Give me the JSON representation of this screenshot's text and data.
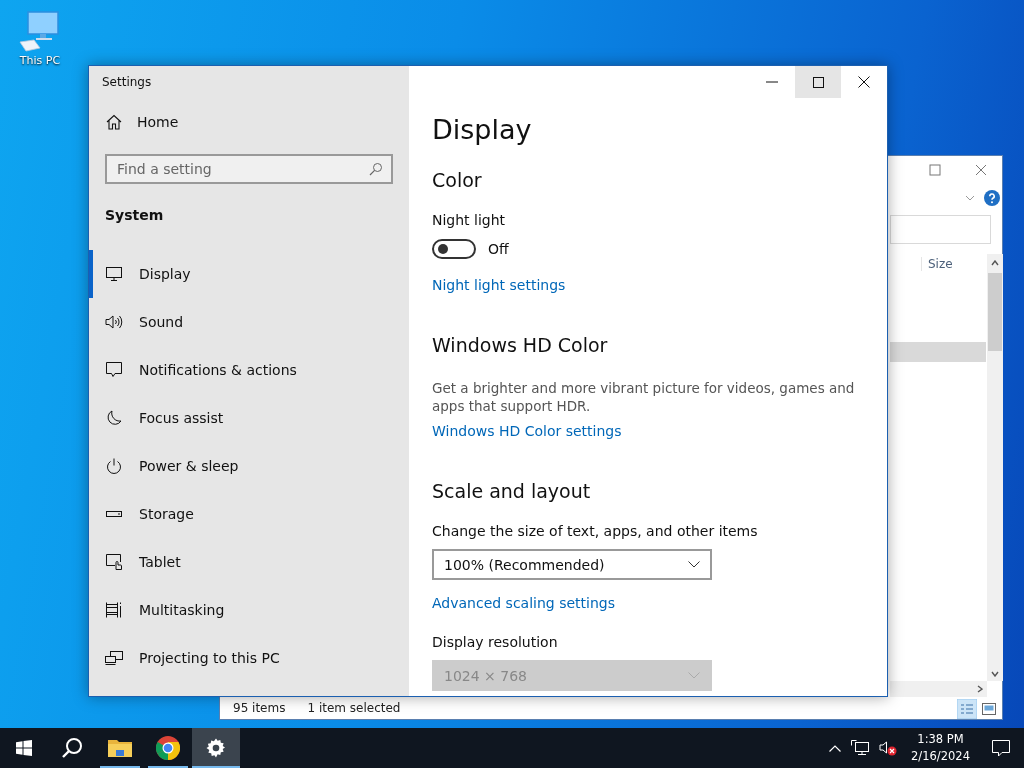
{
  "desktop": {
    "icons": [
      {
        "label": "This PC"
      }
    ]
  },
  "explorer_window": {
    "column_header": "Size",
    "status_bar": {
      "item_count": "95 items",
      "selection": "1 item selected"
    }
  },
  "settings_window": {
    "title": "Settings",
    "home": "Home",
    "search": {
      "placeholder": "Find a setting"
    },
    "section": "System",
    "nav_items": [
      {
        "label": "Display",
        "selected": true
      },
      {
        "label": "Sound",
        "selected": false
      },
      {
        "label": "Notifications & actions",
        "selected": false
      },
      {
        "label": "Focus assist",
        "selected": false
      },
      {
        "label": "Power & sleep",
        "selected": false
      },
      {
        "label": "Storage",
        "selected": false
      },
      {
        "label": "Tablet",
        "selected": false
      },
      {
        "label": "Multitasking",
        "selected": false
      },
      {
        "label": "Projecting to this PC",
        "selected": false
      }
    ],
    "page": {
      "title": "Display",
      "sections": [
        {
          "heading": "Color",
          "items": [
            {
              "kind": "label",
              "text": "Night light"
            },
            {
              "kind": "toggle",
              "on": false,
              "state_text": "Off"
            },
            {
              "kind": "link",
              "text": "Night light settings"
            }
          ]
        },
        {
          "heading": "Windows HD Color",
          "items": [
            {
              "kind": "description",
              "text": "Get a brighter and more vibrant picture for videos, games and apps that support HDR."
            },
            {
              "kind": "link",
              "text": "Windows HD Color settings"
            }
          ]
        },
        {
          "heading": "Scale and layout",
          "items": [
            {
              "kind": "label",
              "text": "Change the size of text, apps, and other items"
            },
            {
              "kind": "dropdown",
              "value": "100% (Recommended)",
              "disabled": false
            },
            {
              "kind": "link",
              "text": "Advanced scaling settings"
            },
            {
              "kind": "label",
              "text": "Display resolution"
            },
            {
              "kind": "dropdown",
              "value": "1024 × 768",
              "disabled": true
            }
          ]
        }
      ]
    }
  },
  "taskbar": {
    "apps": [
      {
        "kind": "start",
        "running": false,
        "active": false
      },
      {
        "kind": "search",
        "running": false,
        "active": false
      },
      {
        "kind": "explorer",
        "running": true,
        "active": false
      },
      {
        "kind": "chrome",
        "running": true,
        "active": false
      },
      {
        "kind": "settings",
        "running": true,
        "active": true
      }
    ],
    "clock": {
      "time": "1:38 PM",
      "date": "2/16/2024"
    }
  }
}
